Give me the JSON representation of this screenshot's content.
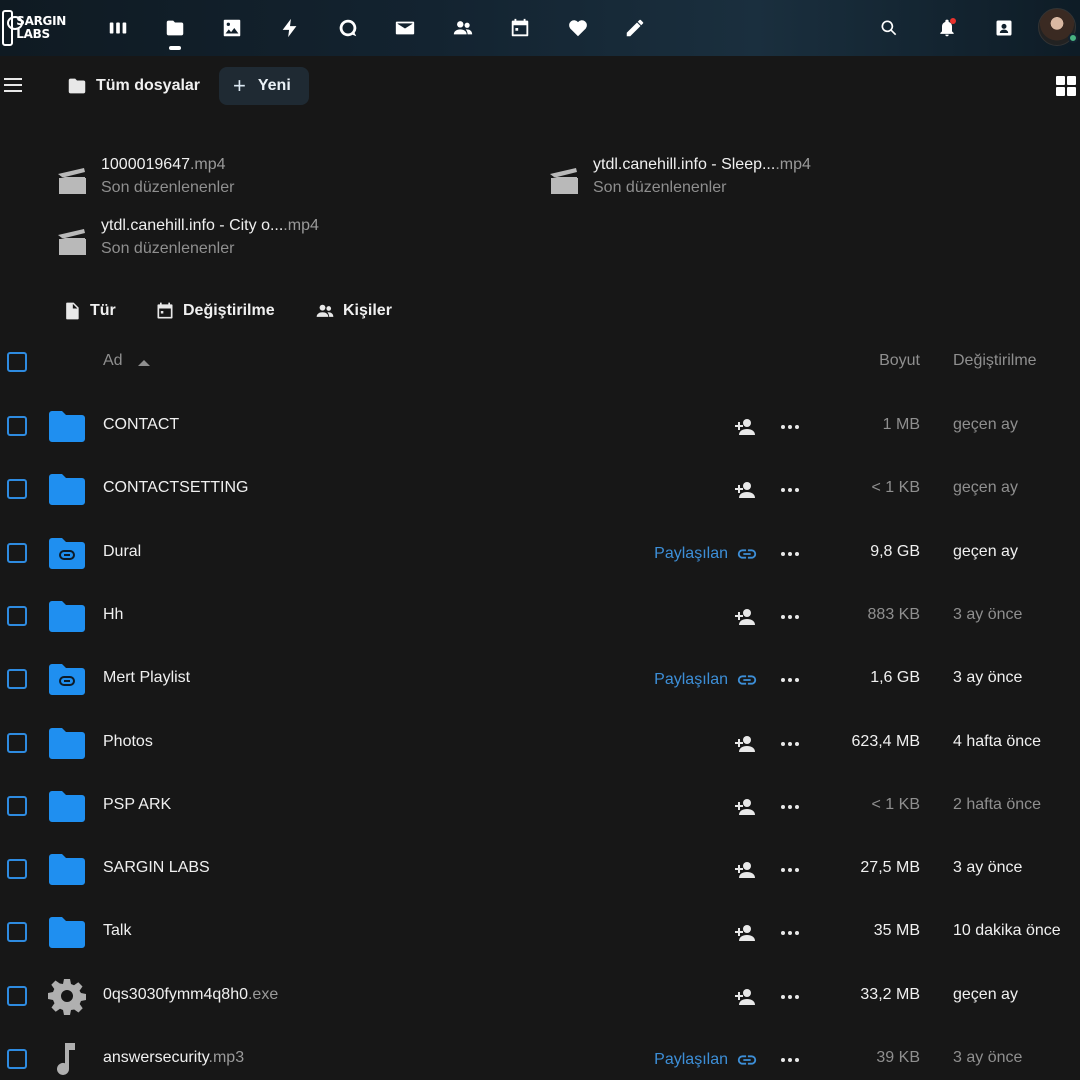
{
  "header": {
    "logo_line1": "SARGIN",
    "logo_line2": "LABS",
    "apps": [
      "dashboard-icon",
      "files-icon",
      "photos-icon",
      "activity-icon",
      "talk-icon",
      "mail-icon",
      "contacts-icon",
      "calendar-icon",
      "favorites-icon",
      "notes-icon"
    ],
    "right": [
      "search-icon",
      "notifications-icon",
      "contacts-menu-icon",
      "avatar"
    ]
  },
  "breadcrumb": {
    "root": "Tüm dosyalar",
    "new_label": "Yeni"
  },
  "recent": [
    {
      "name": "1000019647",
      "ext": ".mp4",
      "sub": "Son düzenlenenler"
    },
    {
      "name": "ytdl.canehill.info - Sleep...",
      "ext": ".mp4",
      "sub": "Son düzenlenenler"
    },
    {
      "name": "ytdl.canehill.info - City o...",
      "ext": ".mp4",
      "sub": "Son düzenlenenler"
    }
  ],
  "filters": {
    "type": "Tür",
    "modified": "Değiştirilme",
    "people": "Kişiler"
  },
  "columns": {
    "name": "Ad",
    "size": "Boyut",
    "modified": "Değiştirilme"
  },
  "shared_label": "Paylaşılan",
  "files": [
    {
      "name": "CONTACT",
      "ext": "",
      "kind": "folder",
      "shared": false,
      "size": "1 MB",
      "modified": "geçen ay",
      "bold": false
    },
    {
      "name": "CONTACTSETTING",
      "ext": "",
      "kind": "folder",
      "shared": false,
      "size": "< 1 KB",
      "modified": "geçen ay",
      "bold": false
    },
    {
      "name": "Dural",
      "ext": "",
      "kind": "folder-link",
      "shared": true,
      "size": "9,8 GB",
      "modified": "geçen ay",
      "bold": true
    },
    {
      "name": "Hh",
      "ext": "",
      "kind": "folder",
      "shared": false,
      "size": "883 KB",
      "modified": "3 ay önce",
      "bold": false
    },
    {
      "name": "Mert Playlist",
      "ext": "",
      "kind": "folder-link",
      "shared": true,
      "size": "1,6 GB",
      "modified": "3 ay önce",
      "bold": true
    },
    {
      "name": "Photos",
      "ext": "",
      "kind": "folder",
      "shared": false,
      "size": "623,4 MB",
      "modified": "4 hafta önce",
      "bold": true
    },
    {
      "name": "PSP ARK",
      "ext": "",
      "kind": "folder",
      "shared": false,
      "size": "< 1 KB",
      "modified": "2 hafta önce",
      "bold": false
    },
    {
      "name": "SARGIN LABS",
      "ext": "",
      "kind": "folder",
      "shared": false,
      "size": "27,5 MB",
      "modified": "3 ay önce",
      "bold": true
    },
    {
      "name": "Talk",
      "ext": "",
      "kind": "folder",
      "shared": false,
      "size": "35 MB",
      "modified": "10 dakika önce",
      "bold": true
    },
    {
      "name": "0qs3030fymm4q8h0",
      "ext": ".exe",
      "kind": "exe",
      "shared": false,
      "size": "33,2 MB",
      "modified": "geçen ay",
      "bold": true
    },
    {
      "name": "answersecurity",
      "ext": ".mp3",
      "kind": "audio",
      "shared": true,
      "size": "39 KB",
      "modified": "3 ay önce",
      "bold": false
    }
  ],
  "colors": {
    "accent": "#2e8be0",
    "folder": "#1f8ff0",
    "background": "#171717"
  }
}
